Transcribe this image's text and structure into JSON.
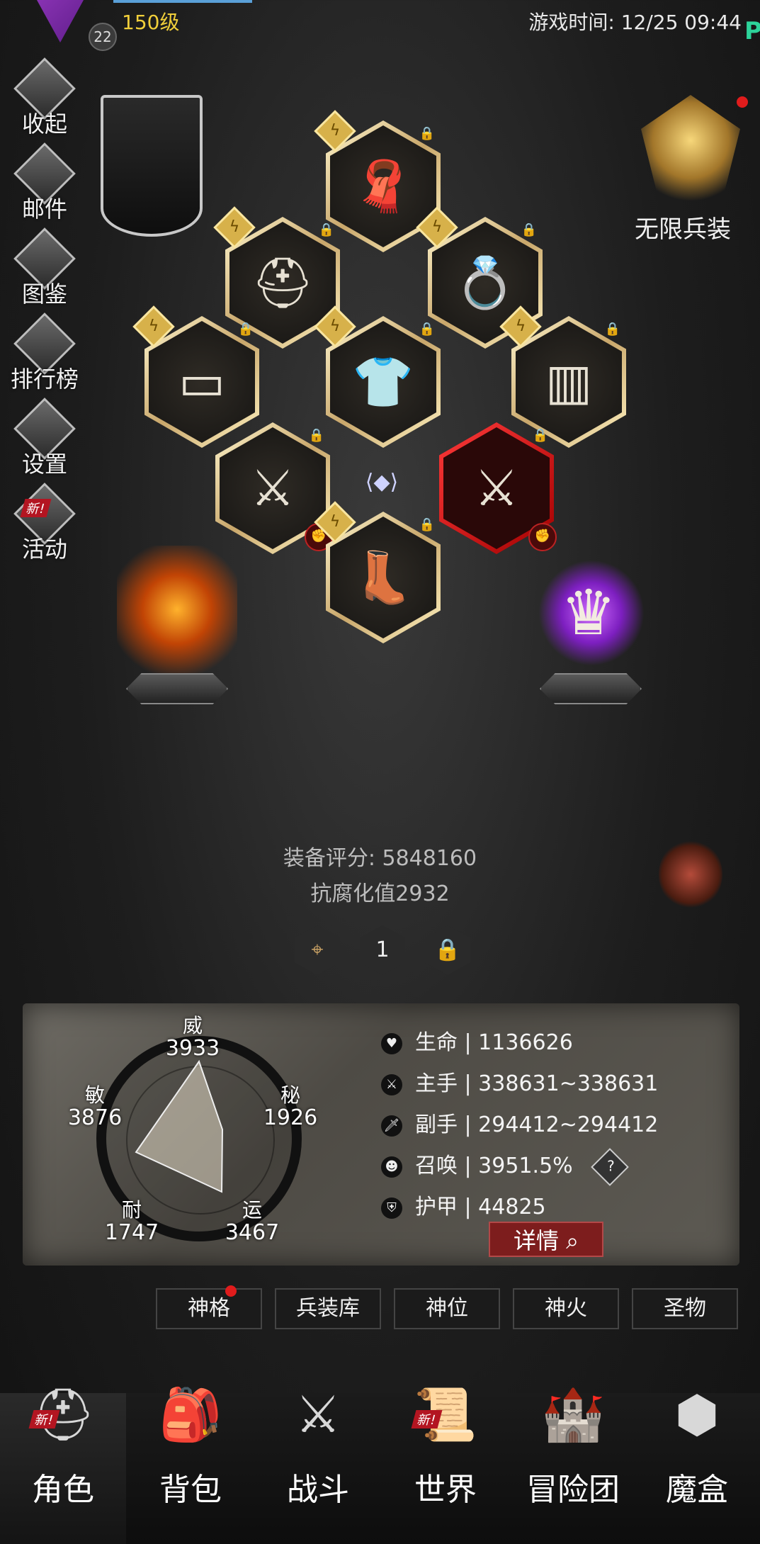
{
  "header": {
    "level": "150级",
    "avatar_level": "22",
    "game_time": "游戏时间: 12/25 09:44"
  },
  "side_menu": [
    {
      "label": "收起",
      "icon": "collapse-icon"
    },
    {
      "label": "邮件",
      "icon": "mail-icon"
    },
    {
      "label": "图鉴",
      "icon": "book-icon"
    },
    {
      "label": "排行榜",
      "icon": "ranking-icon"
    },
    {
      "label": "设置",
      "icon": "gear-icon"
    },
    {
      "label": "活动",
      "icon": "activity-icon",
      "badge": "新!"
    }
  ],
  "infinite_gear": {
    "label": "无限兵装",
    "has_notification": true
  },
  "equipment": {
    "slots": [
      {
        "name": "scarf",
        "glyph": "🧣"
      },
      {
        "name": "helmet",
        "glyph": "⛑"
      },
      {
        "name": "ring",
        "glyph": "💍"
      },
      {
        "name": "belt",
        "glyph": "▭"
      },
      {
        "name": "armor",
        "glyph": "👕"
      },
      {
        "name": "cape",
        "glyph": "▥"
      },
      {
        "name": "main-weapon",
        "glyph": "⚔"
      },
      {
        "name": "offhand-weapon",
        "glyph": "⚔"
      },
      {
        "name": "boots",
        "glyph": "👢"
      }
    ],
    "score_text": "装备评分: 5848160",
    "corruption_resistance": "抗腐化值2932",
    "loadout_selected": "1"
  },
  "attributes": {
    "wei": {
      "label": "威",
      "value": "3933"
    },
    "mi": {
      "label": "秘",
      "value": "1926"
    },
    "yun": {
      "label": "运",
      "value": "3467"
    },
    "nai": {
      "label": "耐",
      "value": "1747"
    },
    "min": {
      "label": "敏",
      "value": "3876"
    }
  },
  "stats": {
    "life": "生命 | 1136626",
    "main_hand": "主手 | 338631~338631",
    "off_hand": "副手 | 294412~294412",
    "summon": "召唤 | 3951.5%",
    "armor": "护甲 | 44825",
    "help": "?",
    "detail_button": "详情"
  },
  "tabs": [
    "神格",
    "兵装库",
    "神位",
    "神火",
    "圣物"
  ],
  "bottom_nav": [
    {
      "label": "角色",
      "badge": "新!",
      "active": true
    },
    {
      "label": "背包"
    },
    {
      "label": "战斗"
    },
    {
      "label": "世界",
      "badge": "新!"
    },
    {
      "label": "冒险团"
    },
    {
      "label": "魔盒"
    }
  ],
  "colors": {
    "level": "#f1cf3a",
    "accent_red": "#7d1d1d",
    "gold": "#d7b14a",
    "new_badge": "#b31521"
  }
}
